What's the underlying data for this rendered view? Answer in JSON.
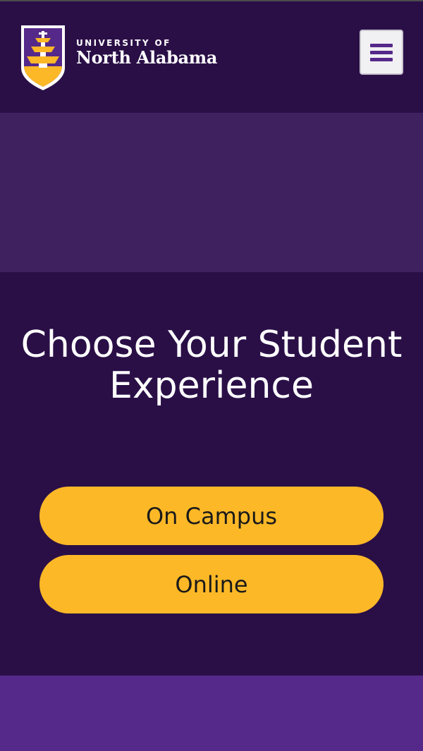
{
  "header": {
    "logo": {
      "line1": "UNIVERSITY OF",
      "line2": "North Alabama",
      "icon": "fountain-shield-icon"
    },
    "menu_icon": "hamburger-menu-icon"
  },
  "hero": {
    "title": "Choose Your Student Experience",
    "buttons": {
      "on_campus": "On Campus",
      "online": "Online"
    }
  },
  "colors": {
    "header_bg": "#2a0f47",
    "hero_band_bg": "#40215f",
    "button_gold": "#fdb827",
    "footer_band_bg": "#55298a",
    "menu_bar_purple": "#55288a"
  }
}
